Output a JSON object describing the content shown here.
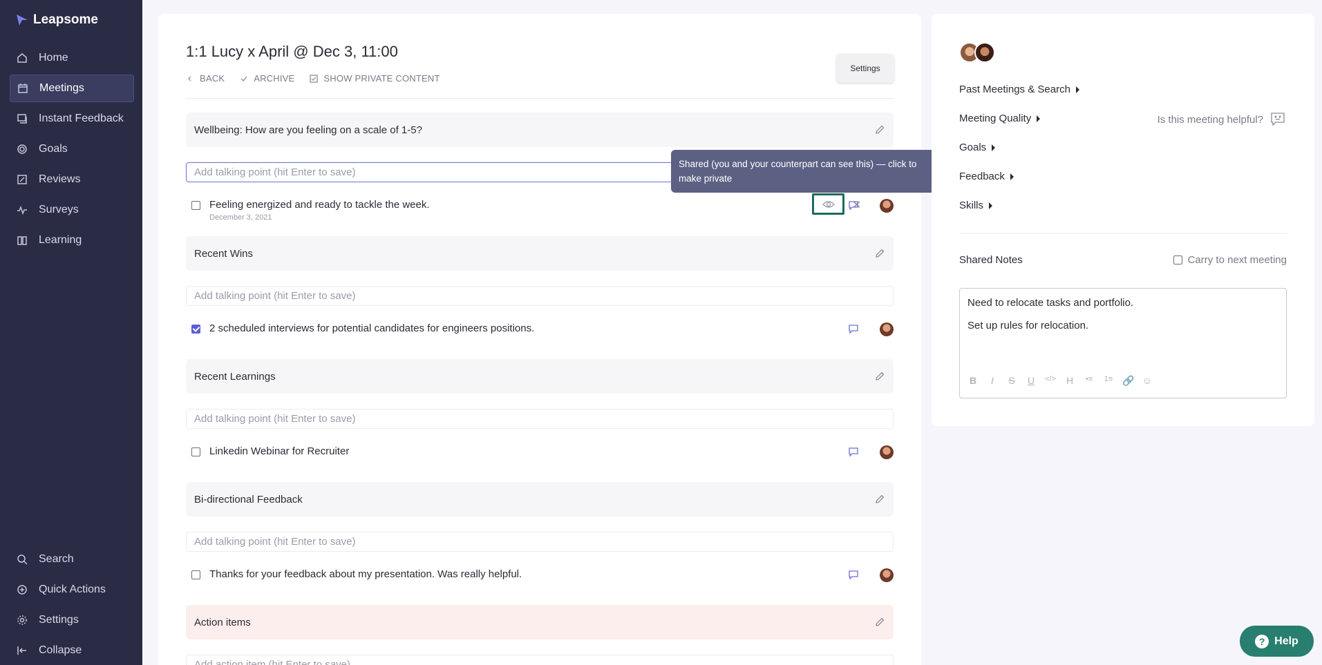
{
  "app": {
    "name": "Leapsome"
  },
  "sidebar": {
    "items": [
      {
        "label": "Home",
        "icon": "home-icon"
      },
      {
        "label": "Meetings",
        "icon": "calendar-icon",
        "active": true
      },
      {
        "label": "Instant Feedback",
        "icon": "feedback-icon"
      },
      {
        "label": "Goals",
        "icon": "target-icon"
      },
      {
        "label": "Reviews",
        "icon": "edit-icon"
      },
      {
        "label": "Surveys",
        "icon": "pulse-icon"
      },
      {
        "label": "Learning",
        "icon": "book-icon"
      }
    ],
    "bottom_items": [
      {
        "label": "Search",
        "icon": "search-icon"
      },
      {
        "label": "Quick Actions",
        "icon": "plus-circle-icon"
      },
      {
        "label": "Settings",
        "icon": "gear-icon"
      },
      {
        "label": "Collapse",
        "icon": "collapse-icon"
      }
    ]
  },
  "meeting": {
    "title": "1:1 Lucy x April @ Dec 3, 11:00",
    "back_label": "BACK",
    "archive_label": "ARCHIVE",
    "private_label": "SHOW PRIVATE CONTENT",
    "settings_label": "Settings"
  },
  "sections": [
    {
      "title": "Wellbeing: How are you feeling on a scale of 1-5?",
      "placeholder": "Add talking point (hit Enter to save)",
      "items": [
        {
          "text": "Feeling energized and ready to tackle the week.",
          "date": "December 3, 2021",
          "checked": false
        }
      ]
    },
    {
      "title": "Recent Wins",
      "placeholder": "Add talking point (hit Enter to save)",
      "items": [
        {
          "text": "2 scheduled interviews for potential candidates for engineers positions.",
          "checked": true
        }
      ]
    },
    {
      "title": "Recent Learnings",
      "placeholder": "Add talking point (hit Enter to save)",
      "items": [
        {
          "text": "Linkedin Webinar for Recruiter",
          "checked": false
        }
      ]
    },
    {
      "title": "Bi-directional Feedback",
      "placeholder": "Add talking point (hit Enter to save)",
      "items": [
        {
          "text": "Thanks for your feedback about my presentation. Was really helpful.",
          "checked": false
        }
      ]
    },
    {
      "title": "Action items",
      "placeholder": "Add action item (hit Enter to save)"
    }
  ],
  "tooltip": {
    "text": "Shared (you and your counterpart can see this) — click to make private"
  },
  "right_panel": {
    "links": [
      "Past Meetings & Search",
      "Meeting Quality",
      "Goals",
      "Feedback",
      "Skills"
    ],
    "helpful_label": "Is this meeting helpful?",
    "notes_title": "Shared Notes",
    "carry_label": "Carry to next meeting",
    "notes": [
      "Need to relocate tasks and portfolio.",
      "Set up rules for relocation."
    ],
    "toolbar": [
      "B",
      "I",
      "S",
      "U",
      "</>",
      "H",
      "•≡",
      "1≡",
      "🔗",
      "☺"
    ]
  },
  "help": {
    "label": "Help"
  },
  "colors": {
    "sidebar": "#2a2b45",
    "accent": "#5b5fd6",
    "help": "#287e6f",
    "tooltip": "#5c6184"
  }
}
